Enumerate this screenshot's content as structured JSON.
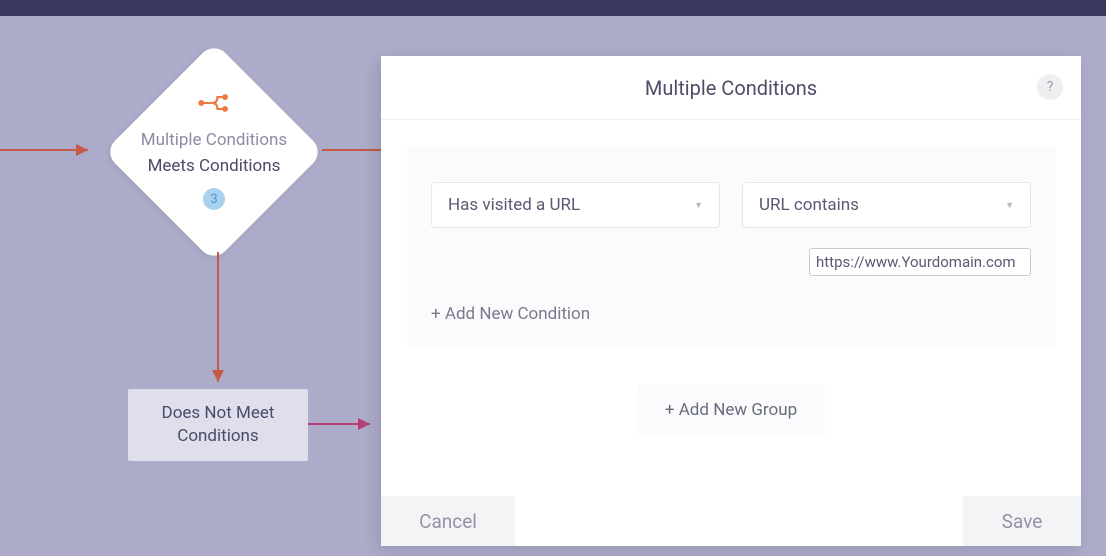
{
  "canvas": {
    "diamond": {
      "title": "Multiple Conditions",
      "subtitle": "Meets Conditions",
      "badge": "3"
    },
    "out_node": {
      "label": "Does Not Meet Conditions"
    }
  },
  "modal": {
    "title": "Multiple Conditions",
    "help_glyph": "?",
    "condition_group": {
      "attribute_select": "Has visited a URL",
      "operator_select": "URL contains",
      "value": "https://www.Yourdomain.com",
      "add_condition_label": "+ Add New Condition"
    },
    "add_group_label": "+ Add New Group",
    "cancel_label": "Cancel",
    "save_label": "Save"
  }
}
